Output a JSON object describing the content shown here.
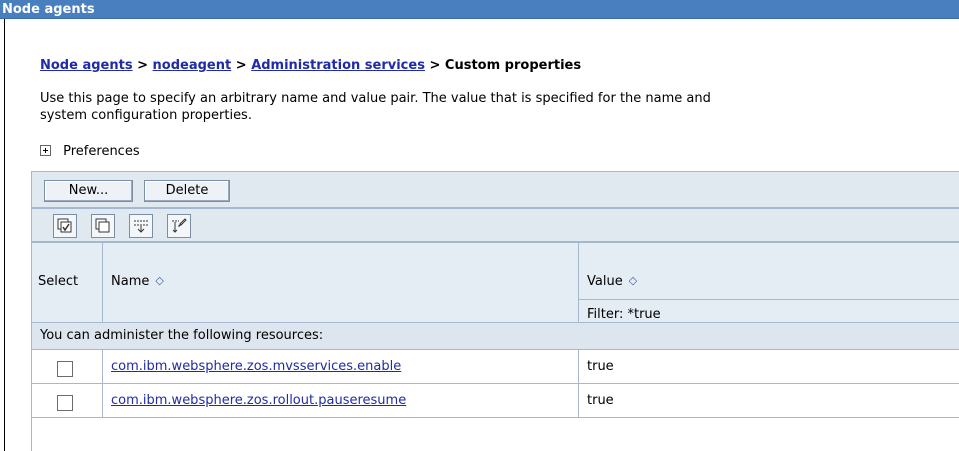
{
  "window": {
    "title": "Node agents"
  },
  "breadcrumb": {
    "items": [
      "Node agents",
      "nodeagent",
      "Administration services"
    ],
    "separator": ">",
    "current": "Custom properties"
  },
  "description": {
    "line1": "Use this page to specify an arbitrary name and value pair. The value that is specified for the name and",
    "line2": "system configuration properties."
  },
  "preferences": {
    "label": "Preferences",
    "icon": "expand-plus-icon"
  },
  "toolbar": {
    "new_label": "New...",
    "delete_label": "Delete"
  },
  "icon_toolbar": {
    "icons": [
      "select-all-icon",
      "deselect-all-icon",
      "show-filter-icon",
      "clear-filter-icon"
    ]
  },
  "table": {
    "columns": {
      "select": "Select",
      "name": "Name",
      "value": "Value"
    },
    "sort_icon": "sort-arrows-icon",
    "filter": "Filter: *true",
    "admin_message": "You can administer the following resources:",
    "rows": [
      {
        "name": "com.ibm.websphere.zos.mvsservices.enable",
        "value": "true",
        "selected": false
      },
      {
        "name": "com.ibm.websphere.zos.rollout.pauseresume",
        "value": "true",
        "selected": false
      }
    ]
  },
  "colors": {
    "titlebar": "#4a7fbf",
    "link": "#1f2ba8",
    "table_header": "#e0e8f0",
    "border": "#a5b8d0"
  }
}
